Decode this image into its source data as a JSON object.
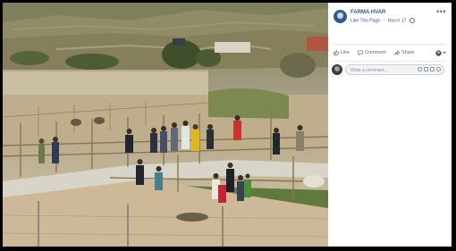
{
  "post": {
    "page_name": "FARMA HVAR",
    "like_page": "Like This Page",
    "separator": "·",
    "date": "March 17",
    "privacy_icon": "globe-icon",
    "more_icon": "more-icon"
  },
  "actions": {
    "like_label": "Like",
    "like_icon": "thumbs-up-icon",
    "comment_label": "Comment",
    "comment_icon": "speech-bubble-icon",
    "share_label": "Share",
    "share_icon": "share-arrow-icon",
    "audience_icon": "page-avatar-dropdown"
  },
  "comment_box": {
    "placeholder": "Write a comment...",
    "icons": [
      "emoji-icon",
      "camera-icon",
      "gif-icon",
      "sticker-icon"
    ]
  },
  "photo": {
    "subject": "people-walking-through-animal-farm-enclosures"
  },
  "colors": {
    "link": "#385898",
    "meta_text": "#616770",
    "viewer_background": "#000000",
    "panel_background": "#ffffff"
  }
}
